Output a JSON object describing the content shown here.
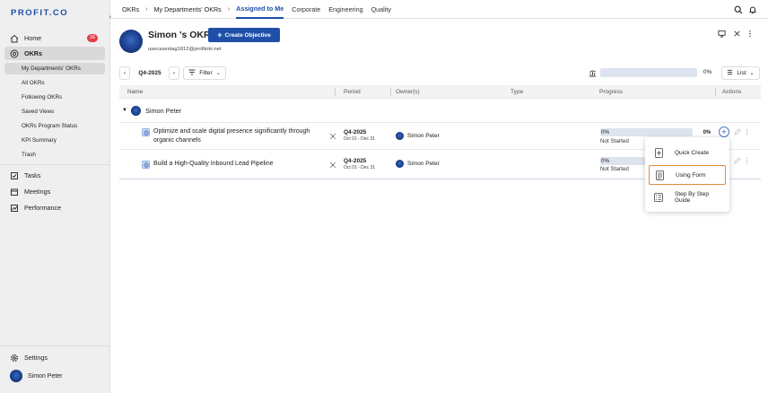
{
  "brand": {
    "logo": "PROFIT.CO",
    "accent": "#1f4fa8"
  },
  "sidebar": {
    "home": {
      "label": "Home",
      "badge": "16"
    },
    "okrs": {
      "label": "OKRs"
    },
    "sub_items": [
      "My Departments' OKRs",
      "All OKRs",
      "Following OKRs",
      "Saved Views",
      "OKRs Program Status",
      "KPI Summary",
      "Trash"
    ],
    "tasks": "Tasks",
    "meetings": "Meetings",
    "performance": "Performance",
    "settings": "Settings",
    "user": "Simon Peter"
  },
  "topbar": {
    "crumb1": "OKRs",
    "crumb2": "My Departments' OKRs",
    "tabs": [
      "Assigned to Me",
      "Corporate",
      "Engineering",
      "Quality"
    ]
  },
  "header": {
    "title": "Simon 's OKRs",
    "email": "usecasestag1812@profitokr.net",
    "create_label": "Create Objective"
  },
  "controls": {
    "period": "Q4-2025",
    "filter": "Filter",
    "overall_pct": "0%",
    "view": "List"
  },
  "table": {
    "columns": [
      "Name",
      "Period",
      "Owner(s)",
      "Type",
      "Progress",
      "Actions"
    ],
    "group": "Simon Peter",
    "rows": [
      {
        "title_line1": "Optimize and scale digital presence significantly through",
        "title_line2": "organic channels",
        "period": "Q4-2025",
        "dates": "Oct 01 - Dec 31",
        "owner": "Simon Peter",
        "progress": "0%",
        "status": "Not Started",
        "pct": "0%"
      },
      {
        "title_line1": "Build a High-Quality Inbound Lead Pipeline",
        "period": "Q4-2025",
        "dates": "Oct 01 - Dec 31",
        "owner": "Simon Peter",
        "progress": "0%",
        "status": "Not Started"
      }
    ]
  },
  "menu": {
    "items": [
      "Quick Create",
      "Using Form",
      "Step By Step Guide"
    ]
  }
}
